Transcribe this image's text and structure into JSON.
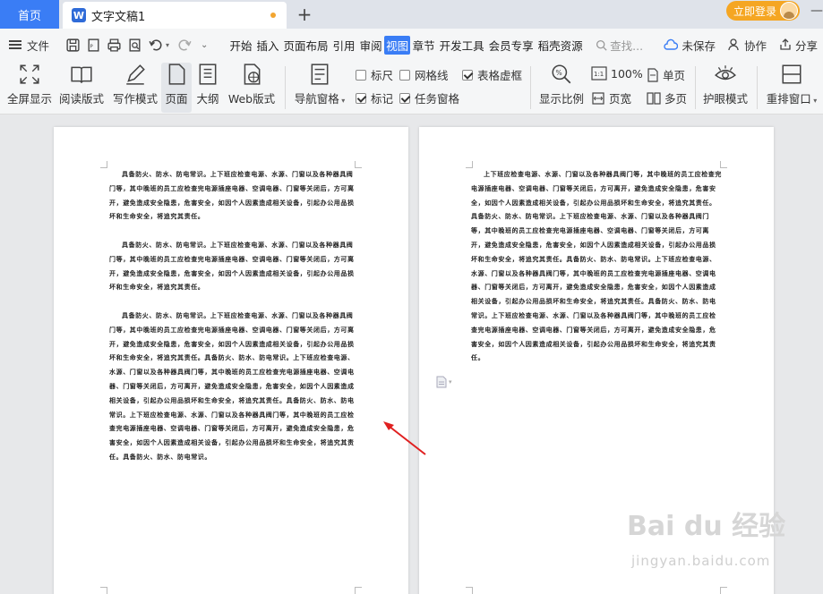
{
  "tabs": {
    "home": "首页",
    "doc_title": "文字文稿1",
    "doc_icon_letter": "W",
    "add": "+"
  },
  "account": {
    "login": "立即登录"
  },
  "menu": {
    "file": "文件",
    "items": [
      "开始",
      "插入",
      "页面布局",
      "引用",
      "审阅",
      "视图",
      "章节",
      "开发工具",
      "会员专享",
      "稻壳资源"
    ],
    "active": "视图",
    "search": "查找...",
    "right": [
      "未保存",
      "协作",
      "分享"
    ]
  },
  "ribbon": {
    "buttons": [
      "全屏显示",
      "阅读版式",
      "写作模式",
      "页面",
      "大纲",
      "Web版式"
    ],
    "nav_pane": "导航窗格",
    "checks": [
      {
        "label": "标尺",
        "checked": false
      },
      {
        "label": "网格线",
        "checked": false
      },
      {
        "label": "表格虚框",
        "checked": true
      },
      {
        "label": "标记",
        "checked": true
      },
      {
        "label": "任务窗格",
        "checked": true
      }
    ],
    "zoom": "显示比例",
    "zoom_100": "100%",
    "page_width": "页宽",
    "single_page": "单页",
    "multi_page": "多页",
    "eye_mode": "护眼模式",
    "rearrange": "重排窗口"
  },
  "document": {
    "page1": [
      "具备防火、防水、防电常识。上下班应检查电源、水源、门窗以及各种器具阀门等，其中晚班的员工应检查完电源插座电器、空调电器、门窗等关闭后，方可离开，避免造成安全隐患，危害安全，如因个人因素造成相关设备，引起办公用品损坏和生命安全，将追究其责任。",
      "具备防火、防水、防电常识。上下班应检查电源、水源、门窗以及各种器具阀门等，其中晚班的员工应检查完电源插座电器、空调电器、门窗等关闭后，方可离开，避免造成安全隐患，危害安全，如因个人因素造成相关设备，引起办公用品损坏和生命安全，将追究其责任。",
      "具备防火、防水、防电常识。上下班应检查电源、水源、门窗以及各种器具阀门等，其中晚班的员工应检查完电源插座电器、空调电器、门窗等关闭后，方可离开，避免造成安全隐患，危害安全，如因个人因素造成相关设备，引起办公用品损坏和生命安全，将追究其责任。具备防火、防水、防电常识。上下班应检查电源、水源、门窗以及各种器具阀门等，其中晚班的员工应检查完电源插座电器、空调电器、门窗等关闭后，方可离开，避免造成安全隐患，危害安全，如因个人因素造成相关设备，引起办公用品损坏和生命安全，将追究其责任。具备防火、防水、防电常识。上下班应检查电源、水源、门窗以及各种器具阀门等，其中晚班的员工应检查完电源插座电器、空调电器、门窗等关闭后，方可离开，避免造成安全隐患，危害安全，如因个人因素造成相关设备，引起办公用品损坏和生命安全，将追究其责任。具备防火、防水、防电常识。"
    ],
    "page2": [
      "上下班应检查电源、水源、门窗以及各种器具阀门等，其中晚班的员工应检查完电源插座电器、空调电器、门窗等关闭后，方可离开，避免造成安全隐患，危害安全，如因个人因素造成相关设备，引起办公用品损坏和生命安全，将追究其责任。具备防火、防水、防电常识。上下班应检查电源、水源、门窗以及各种器具阀门等，其中晚班的员工应检查完电源插座电器、空调电器、门窗等关闭后，方可离开，避免造成安全隐患，危害安全，如因个人因素造成相关设备，引起办公用品损坏和生命安全，将追究其责任。具备防火、防水、防电常识。上下班应检查电源、水源、门窗以及各种器具阀门等，其中晚班的员工应检查完电源插座电器、空调电器、门窗等关闭后，方可离开，避免造成安全隐患，危害安全，如因个人因素造成相关设备，引起办公用品损坏和生命安全，将追究其责任。具备防火、防水、防电常识。上下班应检查电源、水源、门窗以及各种器具阀门等，其中晚班的员工应检查完电源插座电器、空调电器、门窗等关闭后，方可离开，避免造成安全隐患，危害安全，如因个人因素造成相关设备，引起办公用品损坏和生命安全，将追究其责任。"
    ]
  },
  "watermark": {
    "brand": "Bai du 经验",
    "url": "jingyan.baidu.com"
  },
  "colors": {
    "accent": "#3a7df5",
    "login": "#f5a623",
    "arrow": "#e02020"
  }
}
